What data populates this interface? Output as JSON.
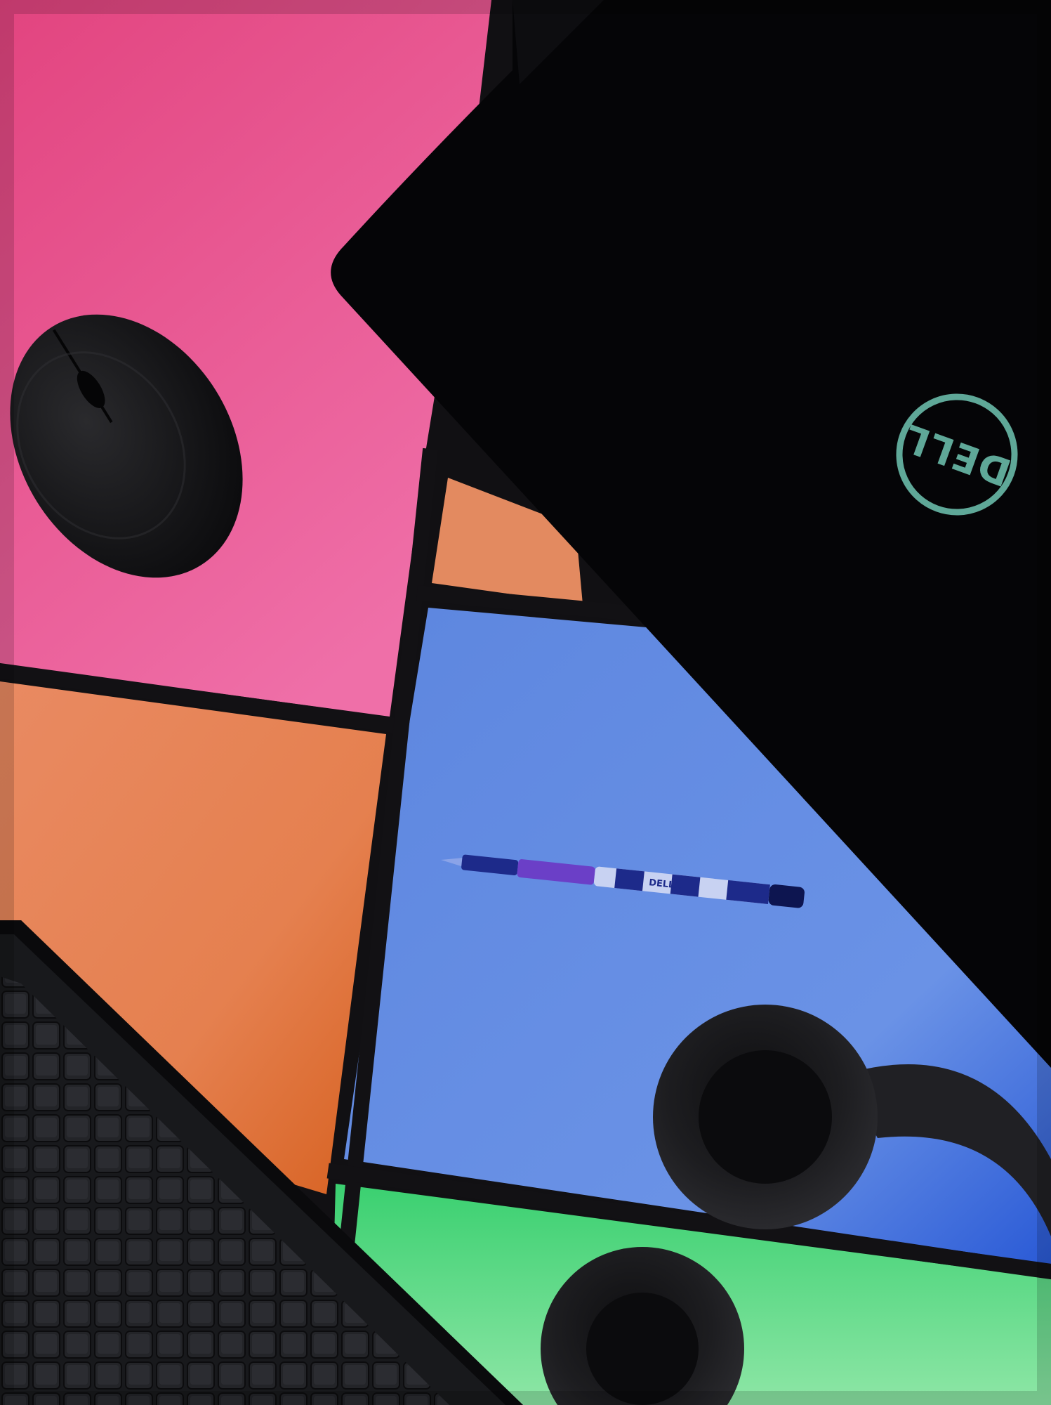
{
  "scene": {
    "title": "",
    "objects": [
      "desk-surface",
      "laptop-lid",
      "wireless-mouse",
      "ballpoint-pen",
      "headphones",
      "keyboard"
    ]
  },
  "laptop": {
    "logo_text": "DELL"
  },
  "pen": {
    "brand_text": "DELLA"
  },
  "colors": {
    "pink": "#e8559a",
    "orange": "#e48a5e",
    "orange_dark": "#d9692e",
    "blue": "#5b86e0",
    "green": "#6fd88f",
    "laptop": "#050507",
    "laptop_logo": "#5fa898",
    "keyboard": "#18191c",
    "mouse": "#141416",
    "headphones": "#151517",
    "pen_body": "#1d2a8a",
    "pen_accent": "#6b3fc7"
  }
}
